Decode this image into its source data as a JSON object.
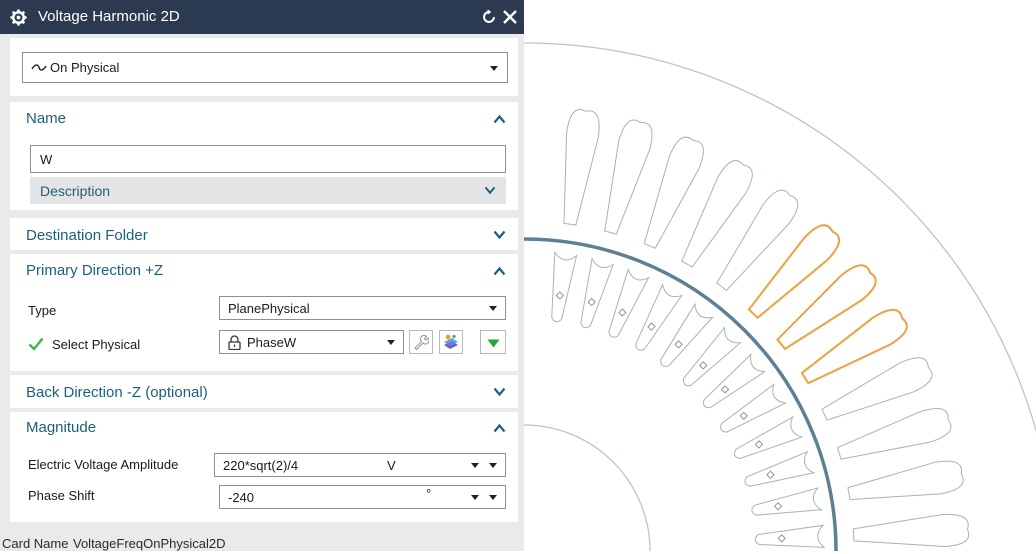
{
  "window": {
    "title": "Voltage Harmonic 2D"
  },
  "mode_select": {
    "value": "On Physical",
    "icon": "tilde-wave-icon"
  },
  "name_section": {
    "header": "Name",
    "name_value": "W",
    "description_label": "Description"
  },
  "destination_section": {
    "header": "Destination Folder"
  },
  "primary_section": {
    "header": "Primary Direction +Z",
    "type_label": "Type",
    "type_value": "PlanePhysical",
    "select_label": "Select Physical",
    "select_value": "PhaseW"
  },
  "back_section": {
    "header": "Back Direction -Z (optional)"
  },
  "magnitude_section": {
    "header": "Magnitude",
    "amplitude_label": "Electric Voltage Amplitude",
    "amplitude_value": "220*sqrt(2)/4",
    "amplitude_unit": "V",
    "phase_label": "Phase Shift",
    "phase_value": "-240",
    "phase_unit": "°"
  },
  "footer": {
    "label": "Card Name",
    "value": "VoltageFreqOnPhysical2D"
  },
  "colors": {
    "titlebar": "#2b3a50",
    "accent": "#1f5f7a",
    "check": "#3bb54a",
    "highlight": "#f0a040",
    "green_button": "#1fa83b"
  }
}
